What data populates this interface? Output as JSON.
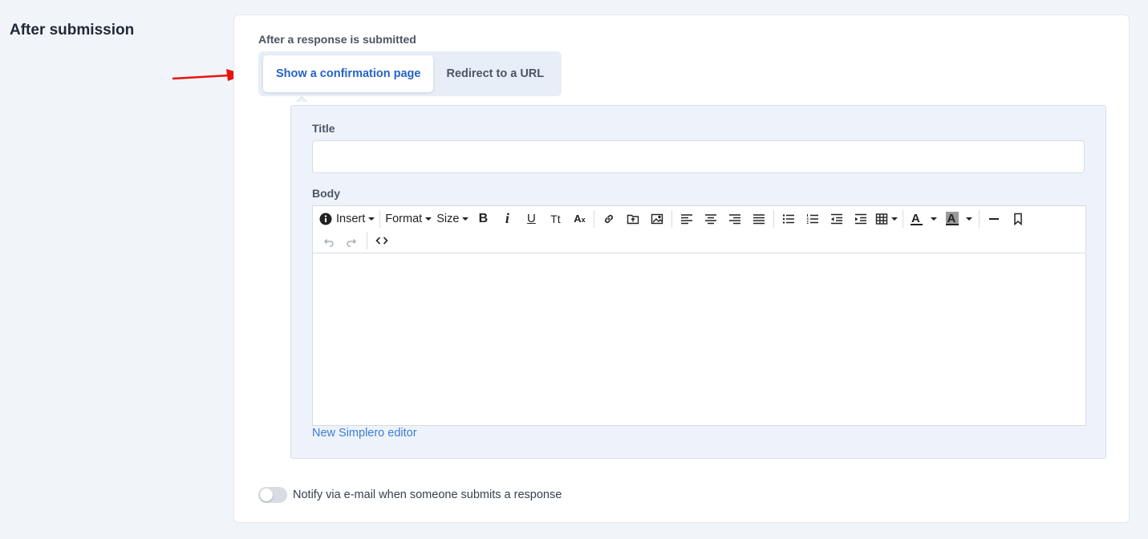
{
  "section": {
    "title": "After submission"
  },
  "after_response": {
    "label": "After a response is submitted",
    "options": [
      {
        "label": "Show a confirmation page",
        "selected": true
      },
      {
        "label": "Redirect to a URL",
        "selected": false
      }
    ]
  },
  "confirmation": {
    "title_label": "Title",
    "title_value": "",
    "body_label": "Body",
    "toolbar": {
      "insert_label": "Insert",
      "format_label": "Format",
      "size_label": "Size",
      "bold_glyph": "B",
      "italic_glyph": "i",
      "underline_glyph": "U",
      "case_glyph": "Tt",
      "clear_glyph": "A"
    },
    "editor_link": "New Simplero editor"
  },
  "notify": {
    "label": "Notify via e-mail when someone submits a response",
    "enabled": false
  },
  "colors": {
    "accent": "#2563c9",
    "link": "#3b7dd8",
    "arrow": "#e8130f",
    "panel_bg": "#eef3fb"
  }
}
